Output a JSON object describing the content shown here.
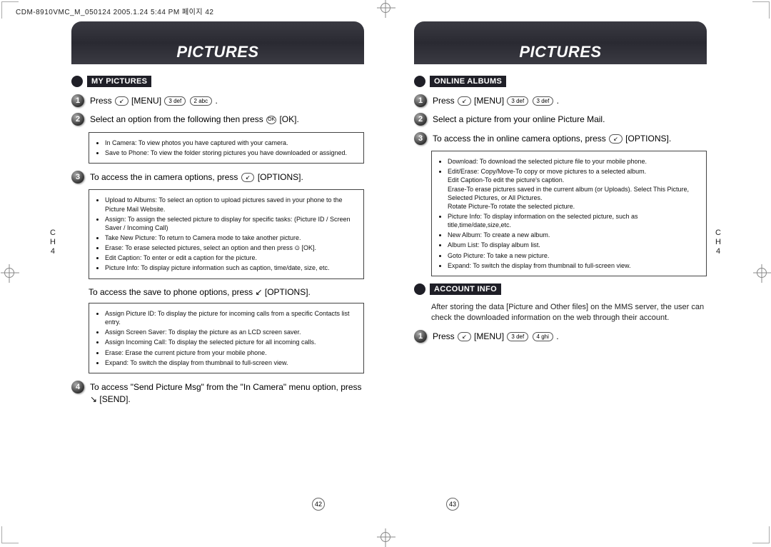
{
  "header_line": "CDM-8910VMC_M_050124 2005.1.24 5:44 PM 페이지 42",
  "left": {
    "banner": "PICTURES",
    "sidebar": "C\nH\n4",
    "section_title": "MY PICTURES",
    "steps": [
      {
        "num": "1",
        "text_before": "Press ",
        "keys": [
          "↙"
        ],
        "text_mid": " [MENU] ",
        "keys2": [
          "3 def",
          "2 abc"
        ],
        "text_after": " ."
      },
      {
        "num": "2",
        "text_before": "Select an option from the following then press ",
        "keys": [
          "OK"
        ],
        "text_mid": " [OK].",
        "keys2": [],
        "text_after": ""
      }
    ],
    "box1_items": [
      "In Camera: To view photos you have captured with your camera.",
      "Save to Phone: To view the folder storing pictures you have downloaded or assigned."
    ],
    "step3": {
      "num": "3",
      "text_before": "To access the in camera options, press ",
      "keys": [
        "↙"
      ],
      "text_after": " [OPTIONS]."
    },
    "box2_items": [
      "Upload to Albums: To select an option to upload pictures saved in your phone to the Picture Mail Website.",
      "Assign: To assign the selected picture to display for specific tasks: (Picture ID / Screen Saver / Incoming Call)",
      "Take New Picture: To return to Camera mode to take another picture.",
      "Erase: To erase selected pictures, select an option and then press ⊙ [OK].",
      "Edit Caption: To enter or edit a caption for the picture.",
      "Picture Info: To display picture information such as caption, time/date, size, etc."
    ],
    "para1": "To access the save to phone options, press ↙ [OPTIONS].",
    "box3_items": [
      "Assign Picture ID: To display the picture for incoming calls from a specific Contacts list entry.",
      "Assign Screen Saver: To display the picture as an LCD screen saver.",
      "Assign Incoming Call: To display the selected picture for all incoming calls.",
      "Erase: Erase the current picture from your mobile phone.",
      "Expand: To switch the display from thumbnail to full-screen view."
    ],
    "step4": {
      "num": "4",
      "text": "To access \"Send Picture Msg\" from the \"In Camera\" menu option, press ↘ [SEND]."
    },
    "pagenum": "42"
  },
  "right": {
    "banner": "PICTURES",
    "sidebar": "C\nH\n4",
    "section1_title": "ONLINE ALBUMS",
    "steps1": [
      {
        "num": "1",
        "text_before": "Press ",
        "keys": [
          "↙"
        ],
        "text_mid": " [MENU] ",
        "keys2": [
          "3 def",
          "3 def"
        ],
        "text_after": " ."
      },
      {
        "num": "2",
        "text": "Select a picture from your online Picture Mail."
      },
      {
        "num": "3",
        "text_before": "To access the in online camera options, press ",
        "keys": [
          "↙"
        ],
        "text_after": " [OPTIONS]."
      }
    ],
    "box1_items": [
      "Download: To download the selected picture file to your mobile phone.",
      "Edit/Erase: Copy/Move-To copy or move pictures to a selected album.\nEdit Caption-To edit the picture's caption.\nErase-To erase pictures saved in the current album (or Uploads). Select This Picture, Selected Pictures, or All Pictures.\nRotate Picture-To rotate the selected picture.",
      "Picture Info: To display information on the selected picture, such as title,time/date,size,etc.",
      "New Album: To create a new album.",
      "Album List: To display album list.",
      "Goto Picture: To take a new picture.",
      "Expand: To switch the display from thumbnail to full-screen view."
    ],
    "section2_title": "ACCOUNT INFO",
    "para1": "After storing the data [Picture and Other files] on the MMS server, the user can check the downloaded information on the web through their account.",
    "step_last": {
      "num": "1",
      "text_before": "Press ",
      "keys": [
        "↙"
      ],
      "text_mid": " [MENU] ",
      "keys2": [
        "3 def",
        "4 ghi"
      ],
      "text_after": " ."
    },
    "pagenum": "43"
  }
}
